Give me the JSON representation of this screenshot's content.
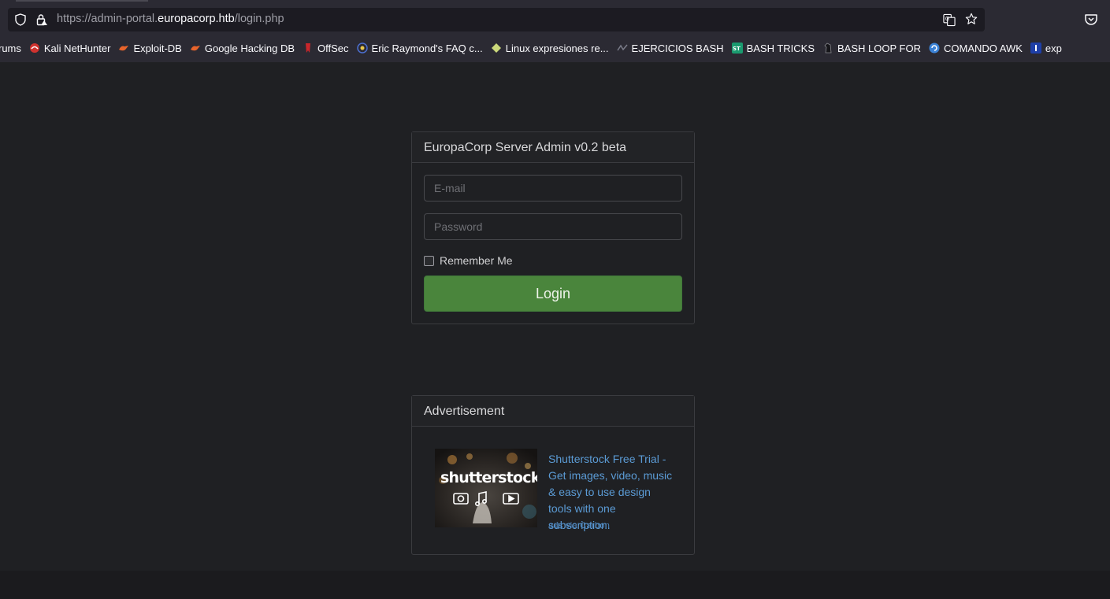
{
  "browser": {
    "url_prefix": "https://admin-portal.",
    "url_domain": "europacorp.htb",
    "url_path": "/login.php",
    "bookmarks": [
      {
        "label": "rums",
        "icon": "none",
        "color": ""
      },
      {
        "label": "Kali NetHunter",
        "icon": "kali-icon",
        "color": "#d0322f"
      },
      {
        "label": "Exploit-DB",
        "icon": "exploitdb-icon",
        "color": "#e8642b"
      },
      {
        "label": "Google Hacking DB",
        "icon": "exploitdb-icon",
        "color": "#e8642b"
      },
      {
        "label": "OffSec",
        "icon": "offsec-icon",
        "color": "#c9262b"
      },
      {
        "label": "Eric Raymond's FAQ c...",
        "icon": "faq-icon",
        "color": "#4b6fd0"
      },
      {
        "label": "Linux expresiones re...",
        "icon": "diamond-icon",
        "color": "#cbd87b"
      },
      {
        "label": "EJERCICIOS BASH",
        "icon": "bash-icon",
        "color": "#7b7d8a"
      },
      {
        "label": "BASH TRICKS",
        "icon": "st-icon",
        "color": "#1a9a6f"
      },
      {
        "label": "BASH LOOP FOR",
        "icon": "horse-icon",
        "color": "#2a2a2e"
      },
      {
        "label": "COMANDO AWK",
        "icon": "awk-icon",
        "color": "#3b82d6"
      },
      {
        "label": "exp",
        "icon": "i-icon",
        "color": "#1e3fa8"
      }
    ]
  },
  "login": {
    "title": "EuropaCorp Server Admin v0.2 beta",
    "email_placeholder": "E-mail",
    "password_placeholder": "Password",
    "remember_label": "Remember Me",
    "login_button": "Login"
  },
  "ad": {
    "title": "Advertisement",
    "brand": "shutterstock",
    "text": "Shutterstock Free Trial - Get images, video, music & easy to use design tools with one subscription.",
    "via": "ads via Carbon"
  }
}
